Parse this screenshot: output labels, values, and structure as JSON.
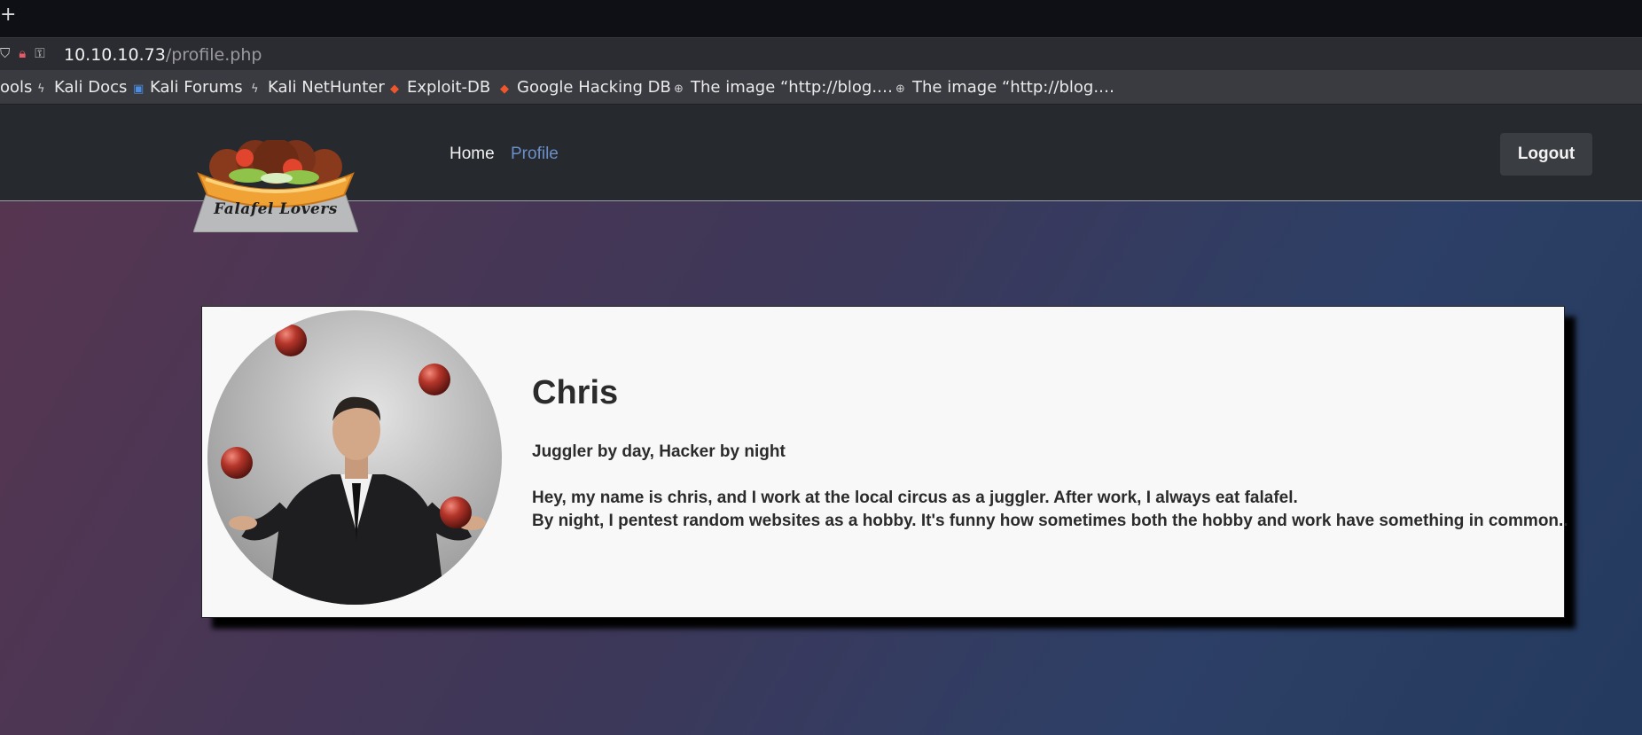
{
  "browser": {
    "new_tab_glyph": "+",
    "url_host": "10.10.10.73",
    "url_path": "/profile.php",
    "bookmarks": [
      {
        "label": "ools",
        "icon": "none"
      },
      {
        "label": "Kali Docs",
        "icon": "kali-dragon-icon"
      },
      {
        "label": "Kali Forums",
        "icon": "kali-forums-icon"
      },
      {
        "label": "Kali NetHunter",
        "icon": "kali-dragon-icon"
      },
      {
        "label": "Exploit-DB",
        "icon": "exploit-db-icon"
      },
      {
        "label": "Google Hacking DB",
        "icon": "exploit-db-icon"
      },
      {
        "label": "The image “http://blog.…",
        "icon": "globe-icon"
      },
      {
        "label": "The image “http://blog.…",
        "icon": "globe-icon"
      }
    ]
  },
  "site": {
    "logo_text": "Falafel Lovers",
    "nav": {
      "home": "Home",
      "profile": "Profile"
    },
    "logout_label": "Logout",
    "active_link_color": "#6b8fc9"
  },
  "profile": {
    "name": "Chris",
    "tagline": "Juggler by day, Hacker by night",
    "bio_line1": "Hey, my name is chris, and I work at the local circus as a juggler. After work, I always eat falafel.",
    "bio_line2": "By night, I pentest random websites as a hobby. It's funny how sometimes both the hobby and work have something in common.."
  }
}
